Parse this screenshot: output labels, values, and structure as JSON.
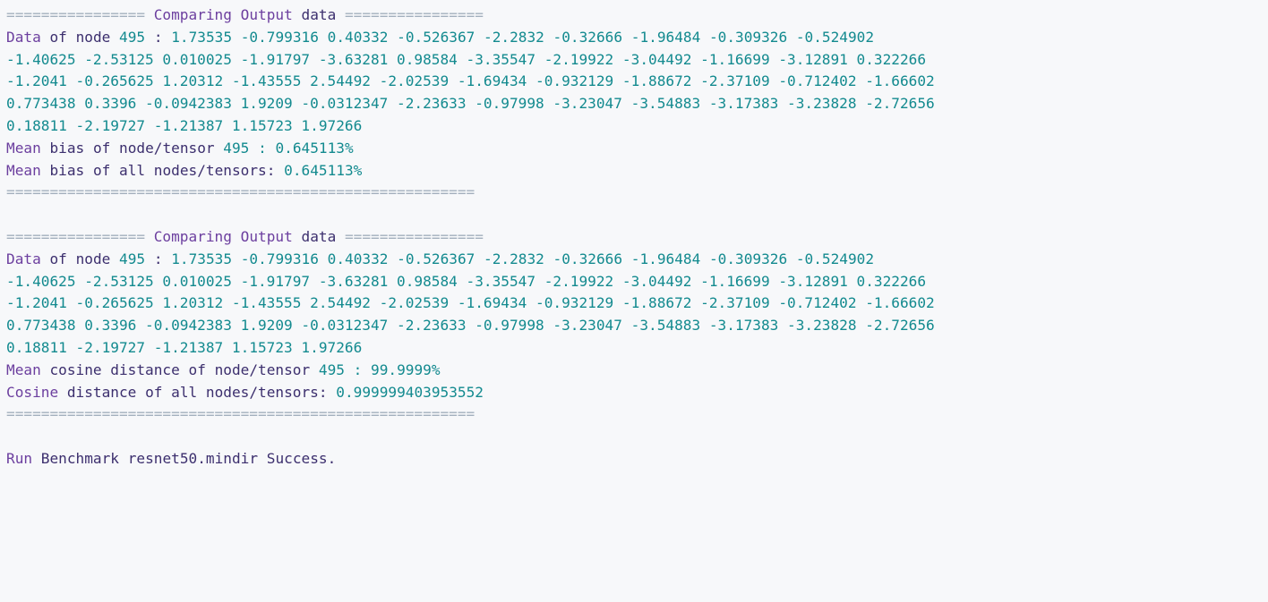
{
  "console": {
    "block1": {
      "header_left": "================",
      "header_word1": "Comparing",
      "header_word2": "Output",
      "header_word3": "data",
      "header_right": "================",
      "data_prefix": "Data",
      "data_of": "of",
      "data_node": "node",
      "node_id": "495",
      "data_sep": ":",
      "values_line1": "1.73535 -0.799316 0.40332 -0.526367 -2.2832 -0.32666 -1.96484 -0.309326 -0.524902",
      "values_line2": "-1.40625 -2.53125 0.010025 -1.91797 -3.63281 0.98584 -3.35547 -2.19922 -3.04492 -1.16699 -3.12891 0.322266",
      "values_line3": "-1.2041 -0.265625 1.20312 -1.43555 2.54492 -2.02539 -1.69434 -0.932129 -1.88672 -2.37109 -0.712402 -1.66602",
      "values_line4": "0.773438 0.3396 -0.0942383 1.9209 -0.0312347 -2.23633 -0.97998 -3.23047 -3.54883 -3.17383 -3.23828 -2.72656",
      "values_line5": "0.18811 -2.19727 -1.21387 1.15723 1.97266",
      "metric1_word1": "Mean",
      "metric1_word2": "bias",
      "metric1_rest": "of node/tensor",
      "metric1_id": "495",
      "metric1_value": ": 0.645113%",
      "metric2_word1": "Mean",
      "metric2_word2": "bias",
      "metric2_rest": "of all nodes/tensors:",
      "metric2_value": "0.645113%",
      "footer": "======================================================"
    },
    "block2": {
      "header_left": "================",
      "header_word1": "Comparing",
      "header_word2": "Output",
      "header_word3": "data",
      "header_right": "================",
      "data_prefix": "Data",
      "data_of": "of",
      "data_node": "node",
      "node_id": "495",
      "data_sep": ":",
      "values_line1": "1.73535 -0.799316 0.40332 -0.526367 -2.2832 -0.32666 -1.96484 -0.309326 -0.524902",
      "values_line2": "-1.40625 -2.53125 0.010025 -1.91797 -3.63281 0.98584 -3.35547 -2.19922 -3.04492 -1.16699 -3.12891 0.322266",
      "values_line3": "-1.2041 -0.265625 1.20312 -1.43555 2.54492 -2.02539 -1.69434 -0.932129 -1.88672 -2.37109 -0.712402 -1.66602",
      "values_line4": "0.773438 0.3396 -0.0942383 1.9209 -0.0312347 -2.23633 -0.97998 -3.23047 -3.54883 -3.17383 -3.23828 -2.72656",
      "values_line5": "0.18811 -2.19727 -1.21387 1.15723 1.97266",
      "metric1_word1": "Mean",
      "metric1_word2": "cosine distance",
      "metric1_rest": "of node/tensor",
      "metric1_id": "495",
      "metric1_value": ": 99.9999%",
      "metric2_word1": "Cosine",
      "metric2_word2": "distance",
      "metric2_rest": "of all nodes/tensors:",
      "metric2_value": "0.999999403953552",
      "footer": "======================================================"
    },
    "final": {
      "word1": "Run",
      "word2": "Benchmark",
      "file": "resnet50.mindir",
      "status": "Success."
    }
  }
}
